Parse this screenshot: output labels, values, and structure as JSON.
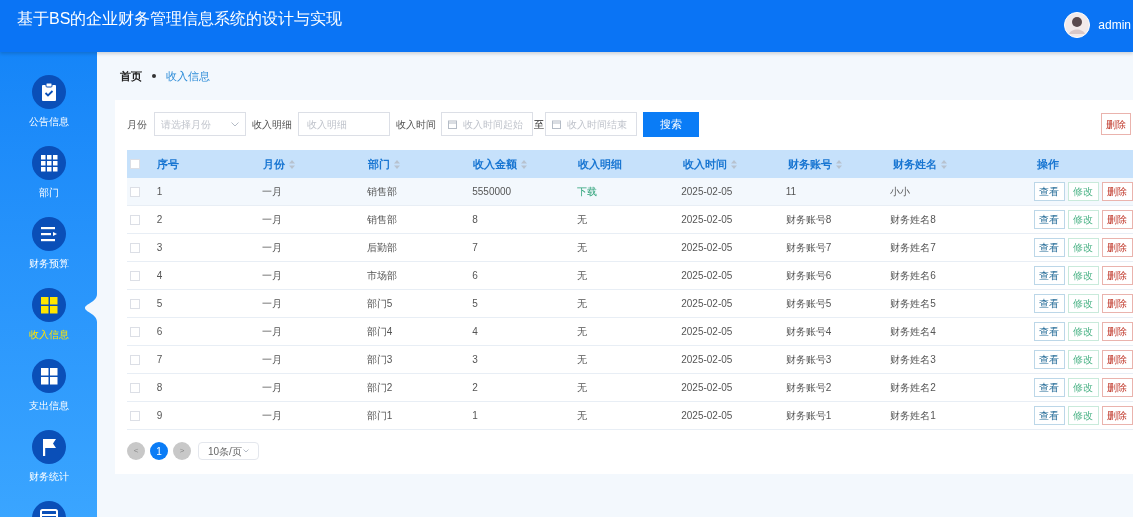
{
  "header": {
    "title": "基于BS的企业财务管理信息系统的设计与实现",
    "user": "admin"
  },
  "sidebar": {
    "items": [
      {
        "label": "公告信息",
        "selected": false
      },
      {
        "label": "部门",
        "selected": false
      },
      {
        "label": "财务预算",
        "selected": false
      },
      {
        "label": "收入信息",
        "selected": true
      },
      {
        "label": "支出信息",
        "selected": false
      },
      {
        "label": "财务统计",
        "selected": false
      }
    ]
  },
  "breadcrumb": [
    "首页",
    "收入信息"
  ],
  "filters": {
    "month": {
      "label": "月份",
      "placeholder": "请选择月份"
    },
    "detail": {
      "label": "收入明细",
      "placeholder": "收入明细"
    },
    "time": {
      "label": "收入时间",
      "start_placeholder": "收入时间起始",
      "separator": "至",
      "end_placeholder": "收入时间结束"
    },
    "search_button": "搜索",
    "delete_button": "删除"
  },
  "table": {
    "columns": [
      {
        "label": "序号",
        "sortable": false
      },
      {
        "label": "月份",
        "sortable": true
      },
      {
        "label": "部门",
        "sortable": true
      },
      {
        "label": "收入金额",
        "sortable": true
      },
      {
        "label": "收入明细",
        "sortable": false
      },
      {
        "label": "收入时间",
        "sortable": true
      },
      {
        "label": "财务账号",
        "sortable": true
      },
      {
        "label": "财务姓名",
        "sortable": true
      },
      {
        "label": "操作",
        "sortable": false
      }
    ],
    "select_all_checked": false,
    "rows": [
      {
        "cells": [
          "1",
          "一月",
          "销售部",
          "5550000",
          "下载",
          "2025-02-05",
          "11",
          "小小"
        ],
        "detail_link": true,
        "checked": false,
        "hovered": true,
        "actions": [
          "查看",
          "修改",
          "删除"
        ]
      },
      {
        "cells": [
          "2",
          "一月",
          "销售部",
          "8",
          "无",
          "2025-02-05",
          "财务账号8",
          "财务姓名8"
        ],
        "detail_link": false,
        "checked": false,
        "hovered": false,
        "actions": [
          "查看",
          "修改",
          "删除"
        ]
      },
      {
        "cells": [
          "3",
          "一月",
          "后勤部",
          "7",
          "无",
          "2025-02-05",
          "财务账号7",
          "财务姓名7"
        ],
        "detail_link": false,
        "checked": false,
        "hovered": false,
        "actions": [
          "查看",
          "修改",
          "删除"
        ]
      },
      {
        "cells": [
          "4",
          "一月",
          "市场部",
          "6",
          "无",
          "2025-02-05",
          "财务账号6",
          "财务姓名6"
        ],
        "detail_link": false,
        "checked": false,
        "hovered": false,
        "actions": [
          "查看",
          "修改",
          "删除"
        ]
      },
      {
        "cells": [
          "5",
          "一月",
          "部门5",
          "5",
          "无",
          "2025-02-05",
          "财务账号5",
          "财务姓名5"
        ],
        "detail_link": false,
        "checked": false,
        "hovered": false,
        "actions": [
          "查看",
          "修改",
          "删除"
        ]
      },
      {
        "cells": [
          "6",
          "一月",
          "部门4",
          "4",
          "无",
          "2025-02-05",
          "财务账号4",
          "财务姓名4"
        ],
        "detail_link": false,
        "checked": false,
        "hovered": false,
        "actions": [
          "查看",
          "修改",
          "删除"
        ]
      },
      {
        "cells": [
          "7",
          "一月",
          "部门3",
          "3",
          "无",
          "2025-02-05",
          "财务账号3",
          "财务姓名3"
        ],
        "detail_link": false,
        "checked": false,
        "hovered": false,
        "actions": [
          "查看",
          "修改",
          "删除"
        ]
      },
      {
        "cells": [
          "8",
          "一月",
          "部门2",
          "2",
          "无",
          "2025-02-05",
          "财务账号2",
          "财务姓名2"
        ],
        "detail_link": false,
        "checked": false,
        "hovered": false,
        "actions": [
          "查看",
          "修改",
          "删除"
        ]
      },
      {
        "cells": [
          "9",
          "一月",
          "部门1",
          "1",
          "无",
          "2025-02-05",
          "财务账号1",
          "财务姓名1"
        ],
        "detail_link": false,
        "checked": false,
        "hovered": false,
        "actions": [
          "查看",
          "修改",
          "删除"
        ]
      }
    ]
  },
  "pagination": {
    "prev": "<",
    "pages": [
      {
        "label": "1",
        "selected": true
      }
    ],
    "next": ">",
    "page_size": "10条/页"
  }
}
